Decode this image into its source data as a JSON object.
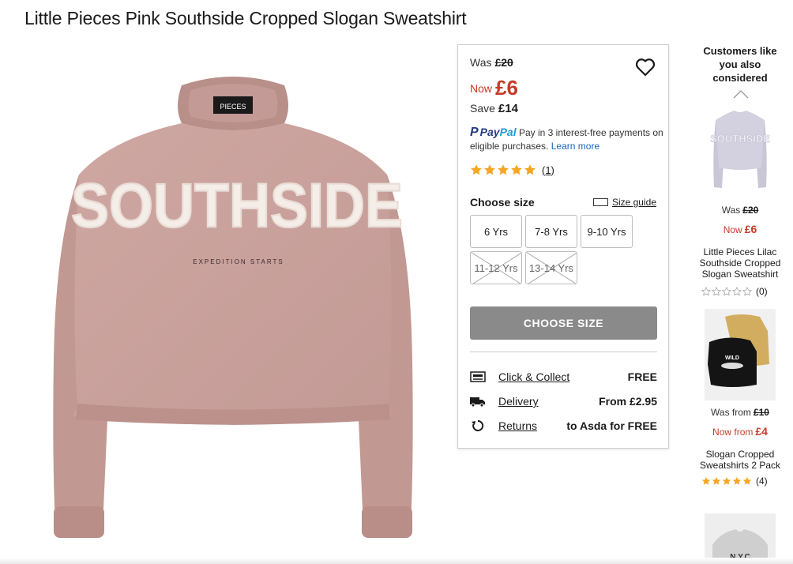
{
  "product": {
    "title": "Little Pieces Pink Southside Cropped Slogan Sweatshirt",
    "image_alt": "pink-cropped-sweatshirt",
    "graphic_text": "SOUTHSIDE",
    "graphic_subtext": "EXPEDITION STARTS",
    "label_text": "PIECES",
    "colors": {
      "garment": "#c9a09b",
      "garment_shadow": "#b58a85"
    }
  },
  "pricing": {
    "was_label": "Was",
    "was_price": "£20",
    "now_label": "Now",
    "now_price": "£6",
    "save_label": "Save",
    "save_amount": "£14",
    "accent_color": "#c43b2a"
  },
  "paypal": {
    "brand_a": "Pay",
    "brand_b": "Pal",
    "text": "Pay in 3 interest-free payments on eligible purchases.",
    "link": "Learn more"
  },
  "rating": {
    "stars": 5,
    "count": "(1)",
    "star_color": "#f5a623"
  },
  "size_selector": {
    "label": "Choose size",
    "guide_label": "Size guide",
    "sizes": [
      {
        "label": "6 Yrs",
        "available": true
      },
      {
        "label": "7-8 Yrs",
        "available": true
      },
      {
        "label": "9-10 Yrs",
        "available": true
      },
      {
        "label": "11-12 Yrs",
        "available": false
      },
      {
        "label": "13-14 Yrs",
        "available": false
      }
    ],
    "button_label": "CHOOSE SIZE"
  },
  "fulfilment": [
    {
      "icon": "click-collect-icon",
      "label": "Click & Collect",
      "value": "FREE"
    },
    {
      "icon": "delivery-truck-icon",
      "label": "Delivery",
      "value": "From £2.95"
    },
    {
      "icon": "returns-icon",
      "label": "Returns",
      "value": "to Asda for FREE"
    }
  ],
  "recommendations": {
    "heading": "Customers like you also considered",
    "items": [
      {
        "was_label": "Was",
        "was": "£20",
        "now_label": "Now",
        "now": "£6",
        "name": "Little Pieces Lilac Southside Cropped Slogan Sweatshirt",
        "stars": 0,
        "count": "(0)",
        "image_text": "SOUTHSIDE"
      },
      {
        "was_label": "Was from",
        "was": "£10",
        "now_label": "Now from",
        "now": "£4",
        "name": "Slogan Cropped Sweatshirts 2 Pack",
        "stars": 5,
        "count": "(4)",
        "image_text": "WILD"
      },
      {
        "image_text": "N.Y.C"
      }
    ]
  }
}
